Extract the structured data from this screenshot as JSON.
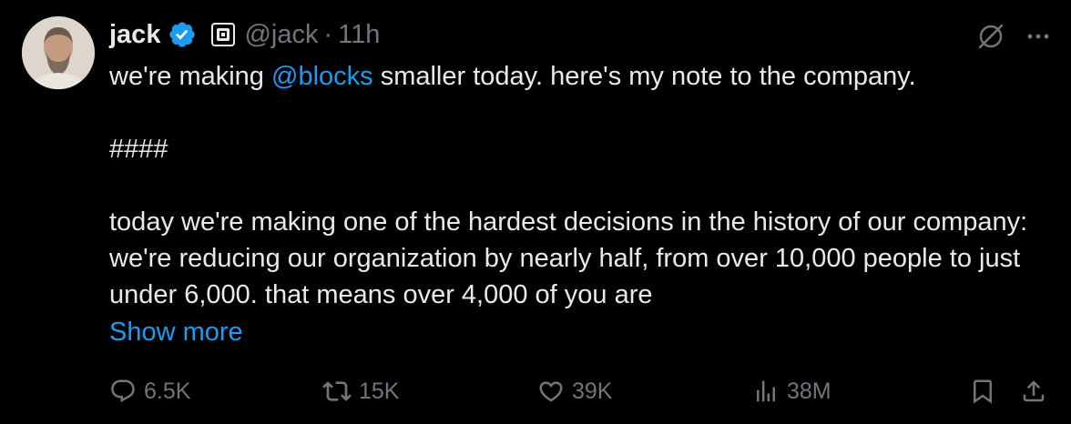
{
  "tweet": {
    "author": {
      "display_name": "jack",
      "handle": "@jack",
      "verified": true,
      "affiliate_badge": "square-logo-icon"
    },
    "separator": "·",
    "timestamp": "11h",
    "body": {
      "line1_prefix": "we're making ",
      "mention": "@blocks",
      "line1_suffix": " smaller today. here's my note to the company.",
      "divider": "####",
      "paragraph": "today we're making one of the hardest decisions in the history of our company: we're reducing our organization by nearly half, from over 10,000 people to just under 6,000. that means over 4,000 of you are"
    },
    "show_more": "Show more",
    "stats": {
      "replies": "6.5K",
      "reposts": "15K",
      "likes": "39K",
      "views": "38M"
    }
  },
  "colors": {
    "background": "#000000",
    "text": "#e7e9ea",
    "muted": "#71767b",
    "accent": "#1d9bf0"
  },
  "icons": {
    "top_right": [
      "grok-icon",
      "more-icon"
    ],
    "actions": [
      "reply-icon",
      "repost-icon",
      "like-icon",
      "views-icon",
      "bookmark-icon",
      "share-icon"
    ]
  }
}
